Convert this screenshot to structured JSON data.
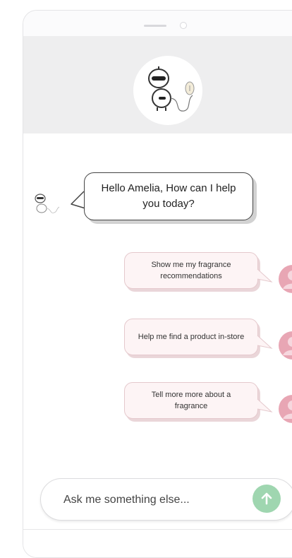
{
  "bot_message": "Hello Amelia, How can I help you today?",
  "quick_replies": [
    {
      "label": "Show me my fragrance recommendations"
    },
    {
      "label": "Help me find a product in-store"
    },
    {
      "label": "Tell more more about a fragrance"
    }
  ],
  "composer": {
    "placeholder": "Ask me something else...",
    "send_icon": "arrow-up-icon"
  },
  "colors": {
    "send_button": "#9fd6b0",
    "user_avatar": "#e8a6b4",
    "reply_bubble": "#fdf4f5"
  }
}
